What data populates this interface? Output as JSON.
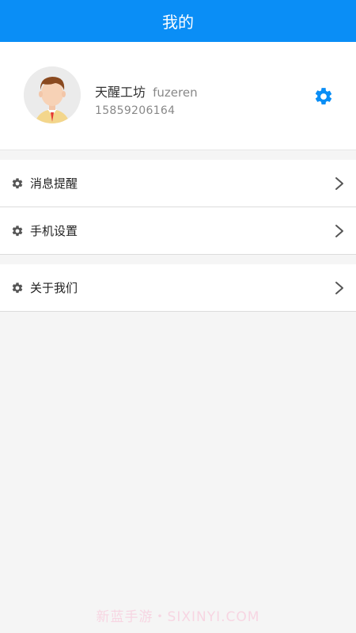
{
  "header": {
    "title": "我的"
  },
  "profile": {
    "display_name": "天醒工坊",
    "username": "fuzeren",
    "phone": "15859206164"
  },
  "menu_groups": [
    {
      "items": [
        {
          "label": "消息提醒"
        },
        {
          "label": "手机设置"
        }
      ]
    },
    {
      "items": [
        {
          "label": "关于我们"
        }
      ]
    }
  ],
  "watermark": "新蓝手游・SIXINYI.COM",
  "colors": {
    "header_bg": "#0a8ef6",
    "accent_gear": "#0a8ef6",
    "menu_icon": "#555555",
    "page_bg": "#f5f5f5"
  }
}
